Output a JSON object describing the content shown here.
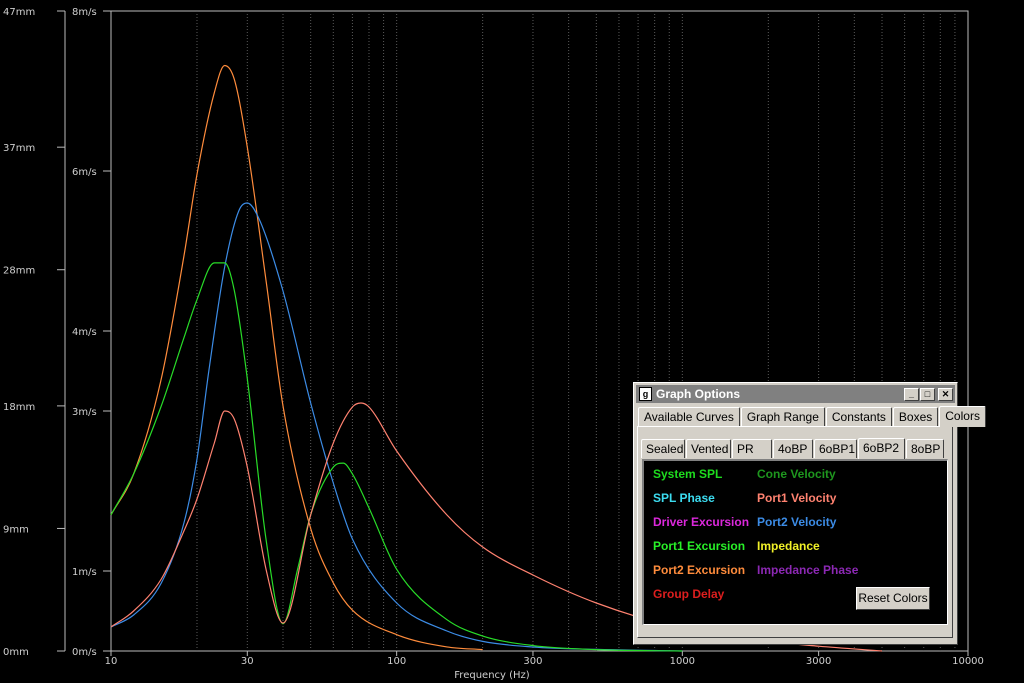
{
  "chart_data": {
    "type": "line",
    "xlabel": "Frequency (Hz)",
    "xscale": "log",
    "xlim": [
      10,
      10000
    ],
    "x_tick_labels": [
      "10",
      "30",
      "100",
      "300",
      "1000",
      "3000",
      "10000"
    ],
    "x_ticks": [
      10,
      30,
      100,
      300,
      1000,
      3000,
      10000
    ],
    "left_axis_1": {
      "ylim": [
        0,
        47
      ],
      "tick_labels": [
        "0mm",
        "9mm",
        "18mm",
        "28mm",
        "37mm",
        "47mm"
      ],
      "ticks": [
        0,
        9,
        18,
        28,
        37,
        47
      ]
    },
    "left_axis_2": {
      "ylim": [
        0,
        8
      ],
      "tick_labels": [
        "0m/s",
        "1m/s",
        "3m/s",
        "4m/s",
        "6m/s",
        "8m/s"
      ],
      "ticks": [
        0,
        1,
        3,
        4,
        6,
        8
      ]
    },
    "grid": true,
    "series": [
      {
        "name": "Port2 Excursion",
        "color": "#ff8c3c",
        "axis": "left_axis_1",
        "x": [
          10,
          12,
          15,
          18,
          20,
          23,
          25,
          27,
          30,
          35,
          40,
          50,
          60,
          70,
          100,
          150,
          200
        ],
        "y": [
          10.0,
          13.0,
          20.0,
          29.0,
          35.0,
          41.0,
          43.0,
          42.0,
          37.0,
          27.0,
          18.0,
          9.0,
          5.0,
          3.0,
          1.2,
          0.3,
          0.1
        ]
      },
      {
        "name": "Port2 Velocity",
        "color": "#3c8ce6",
        "axis": "left_axis_2",
        "x": [
          10,
          12,
          15,
          18,
          20,
          22,
          25,
          28,
          30,
          33,
          40,
          50,
          60,
          70,
          100,
          150,
          200,
          300,
          500,
          1000
        ],
        "y": [
          0.3,
          0.45,
          0.85,
          1.6,
          2.4,
          3.5,
          4.8,
          5.5,
          5.6,
          5.4,
          4.5,
          3.1,
          2.1,
          1.4,
          0.6,
          0.25,
          0.12,
          0.05,
          0.02,
          0.0
        ]
      },
      {
        "name": "Port1 Excursion",
        "color": "#28dc28",
        "axis": "left_axis_1",
        "x": [
          10,
          12,
          15,
          18,
          20,
          23,
          25,
          27,
          30,
          35,
          40,
          45,
          50,
          60,
          65,
          70,
          80,
          100,
          150,
          200,
          300,
          500,
          1000
        ],
        "y": [
          10.0,
          13.0,
          18.0,
          23.0,
          25.8,
          28.5,
          28.5,
          26.5,
          20.0,
          8.0,
          2.0,
          6.0,
          10.0,
          13.5,
          13.8,
          13.0,
          10.5,
          6.0,
          2.3,
          1.1,
          0.4,
          0.1,
          0.0
        ]
      },
      {
        "name": "Port1 Velocity",
        "color": "#ff8270",
        "axis": "left_axis_2",
        "x": [
          10,
          12,
          15,
          18,
          20,
          23,
          25,
          27,
          30,
          35,
          40,
          50,
          60,
          70,
          75,
          80,
          100,
          150,
          200,
          300,
          500,
          1000,
          2000,
          3000,
          5000
        ],
        "y": [
          0.3,
          0.5,
          0.9,
          1.5,
          1.9,
          2.6,
          3.0,
          2.9,
          2.3,
          1.0,
          0.35,
          1.7,
          2.6,
          3.05,
          3.1,
          3.05,
          2.5,
          1.7,
          1.3,
          0.95,
          0.6,
          0.28,
          0.12,
          0.06,
          0.0
        ]
      }
    ]
  },
  "graph_options": {
    "app_icon": "g",
    "title": "Graph Options",
    "window_buttons": {
      "minimize": "_",
      "maximize": "□",
      "close": "✕"
    },
    "tabs": [
      "Available Curves",
      "Graph Range",
      "Constants",
      "Boxes",
      "Colors"
    ],
    "active_tab": "Colors",
    "subtabs": [
      "Sealed",
      "Vented",
      "PR",
      "4oBP",
      "6oBP1",
      "6oBP2",
      "8oBP"
    ],
    "active_subtab": "6oBP2",
    "color_items_left": [
      {
        "label": "System SPL",
        "color": "#1edc1e"
      },
      {
        "label": "SPL Phase",
        "color": "#3cdcf0"
      },
      {
        "label": "Driver Excursion",
        "color": "#dc28dc"
      },
      {
        "label": "Port1 Excursion",
        "color": "#28f028"
      },
      {
        "label": "Port2 Excursion",
        "color": "#ff8c3c"
      },
      {
        "label": "Group Delay",
        "color": "#dc1e1e"
      }
    ],
    "color_items_right": [
      {
        "label": "Cone Velocity",
        "color": "#1e961e"
      },
      {
        "label": "Port1 Velocity",
        "color": "#ff8270"
      },
      {
        "label": "Port2 Velocity",
        "color": "#3c8ce6"
      },
      {
        "label": "Impedance",
        "color": "#f0f028"
      },
      {
        "label": "Impedance Phase",
        "color": "#8c28b4"
      }
    ],
    "reset_button": "Reset Colors"
  }
}
